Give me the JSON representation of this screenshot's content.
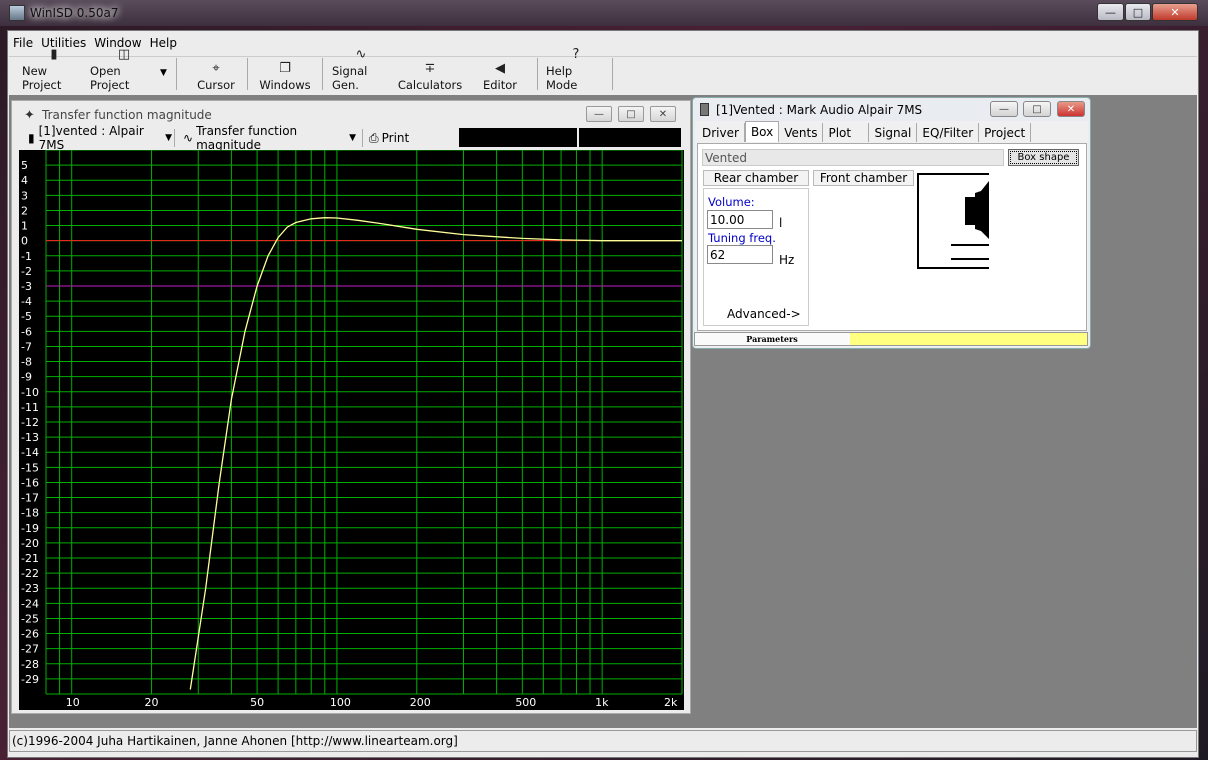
{
  "app": {
    "title": "WinISD 0.50a7"
  },
  "menu": [
    {
      "label": "File"
    },
    {
      "label": "Utilities"
    },
    {
      "label": "Window"
    },
    {
      "label": "Help"
    }
  ],
  "toolbar": {
    "new_project": "New Project",
    "open_project": "Open Project",
    "cursor": "Cursor",
    "windows": "Windows",
    "signal_gen": "Signal Gen.",
    "calculators": "Calculators",
    "editor": "Editor",
    "help_mode": "Help Mode"
  },
  "graph_window": {
    "title": "Transfer function magnitude",
    "project_dropdown": "[1]vented : Alpair 7MS",
    "graph_dropdown": "Transfer function magnitude",
    "print": "Print"
  },
  "chart_data": {
    "type": "line",
    "xscale": "log",
    "xlim": [
      8,
      2000
    ],
    "ylim": [
      -30,
      6
    ],
    "x_ticks": [
      "10",
      "20",
      "50",
      "100",
      "200",
      "500",
      "1k",
      "2k"
    ],
    "x_tick_values": [
      10,
      20,
      50,
      100,
      200,
      500,
      1000,
      2000
    ],
    "y_ticks": [
      "5",
      "4",
      "3",
      "2",
      "1",
      "0",
      "-1",
      "-2",
      "-3",
      "-4",
      "-5",
      "-6",
      "-7",
      "-8",
      "-9",
      "-10",
      "-11",
      "-12",
      "-13",
      "-14",
      "-15",
      "-16",
      "-17",
      "-18",
      "-19",
      "-20",
      "-21",
      "-22",
      "-23",
      "-24",
      "-25",
      "-26",
      "-27",
      "-28",
      "-29"
    ],
    "y_tick_values": [
      5,
      4,
      3,
      2,
      1,
      0,
      -1,
      -2,
      -3,
      -4,
      -5,
      -6,
      -7,
      -8,
      -9,
      -10,
      -11,
      -12,
      -13,
      -14,
      -15,
      -16,
      -17,
      -18,
      -19,
      -20,
      -21,
      -22,
      -23,
      -24,
      -25,
      -26,
      -27,
      -28,
      -29
    ],
    "grid": true,
    "reference_lines": [
      {
        "y": 0,
        "color": "#ff2020"
      },
      {
        "y": -3,
        "color": "#c020c0"
      }
    ],
    "series": [
      {
        "color": "#ffff9a",
        "x": [
          28,
          32,
          36,
          40,
          45,
          50,
          55,
          60,
          65,
          70,
          80,
          90,
          100,
          120,
          150,
          200,
          300,
          500,
          700,
          1000,
          2000
        ],
        "y": [
          -29.7,
          -23.0,
          -16.0,
          -10.5,
          -6.0,
          -3.0,
          -1.0,
          0.2,
          0.9,
          1.2,
          1.45,
          1.52,
          1.5,
          1.35,
          1.1,
          0.75,
          0.4,
          0.15,
          0.05,
          0.0,
          0.0
        ]
      }
    ]
  },
  "box_window": {
    "title": "[1]Vented : Mark Audio Alpair 7MS",
    "tabs": [
      "Driver",
      "Box",
      "Vents",
      "Plot",
      "Signal",
      "EQ/Filter",
      "Project"
    ],
    "active_tab": "Box",
    "box_type": "Vented",
    "box_shape_button": "Box shape",
    "rear_chamber": "Rear chamber",
    "front_chamber": "Front chamber",
    "volume_label": "Volume:",
    "volume_value": "10.00",
    "volume_unit": "l",
    "tuning_label": "Tuning freq.",
    "tuning_value": "62",
    "tuning_unit": "Hz",
    "advanced": "Advanced->",
    "status_parameters": "Parameters"
  },
  "statusbar": {
    "text": "(c)1996-2004 Juha Hartikainen, Janne Ahonen [http://www.linearteam.org]"
  }
}
